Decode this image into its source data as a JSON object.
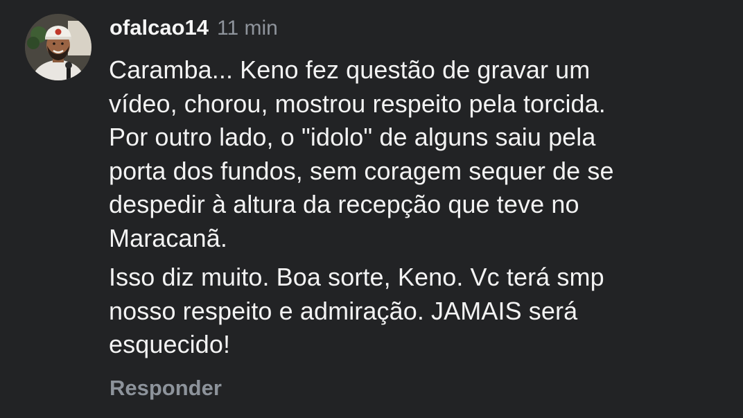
{
  "comment": {
    "username": "ofalcao14",
    "timestamp": "11 min",
    "paragraphs": [
      {
        "lines": [
          "Caramba... Keno fez questão de gravar um",
          "vídeo, chorou, mostrou respeito pela torcida.",
          "Por outro lado, o \"idolo\" de alguns saiu pela",
          "porta dos fundos, sem coragem sequer de se",
          "despedir à altura da recepção que teve no",
          "Maracanã."
        ]
      },
      {
        "lines": [
          "Isso diz muito. Boa sorte, Keno. Vc terá smp",
          "nosso respeito e admiração. JAMAIS será",
          "esquecido!"
        ]
      }
    ],
    "reply_label": "Responder",
    "avatar_icon": "user-avatar-icon"
  },
  "colors": {
    "background": "#222325",
    "text": "#f3f3f3",
    "muted": "#8f949c"
  }
}
